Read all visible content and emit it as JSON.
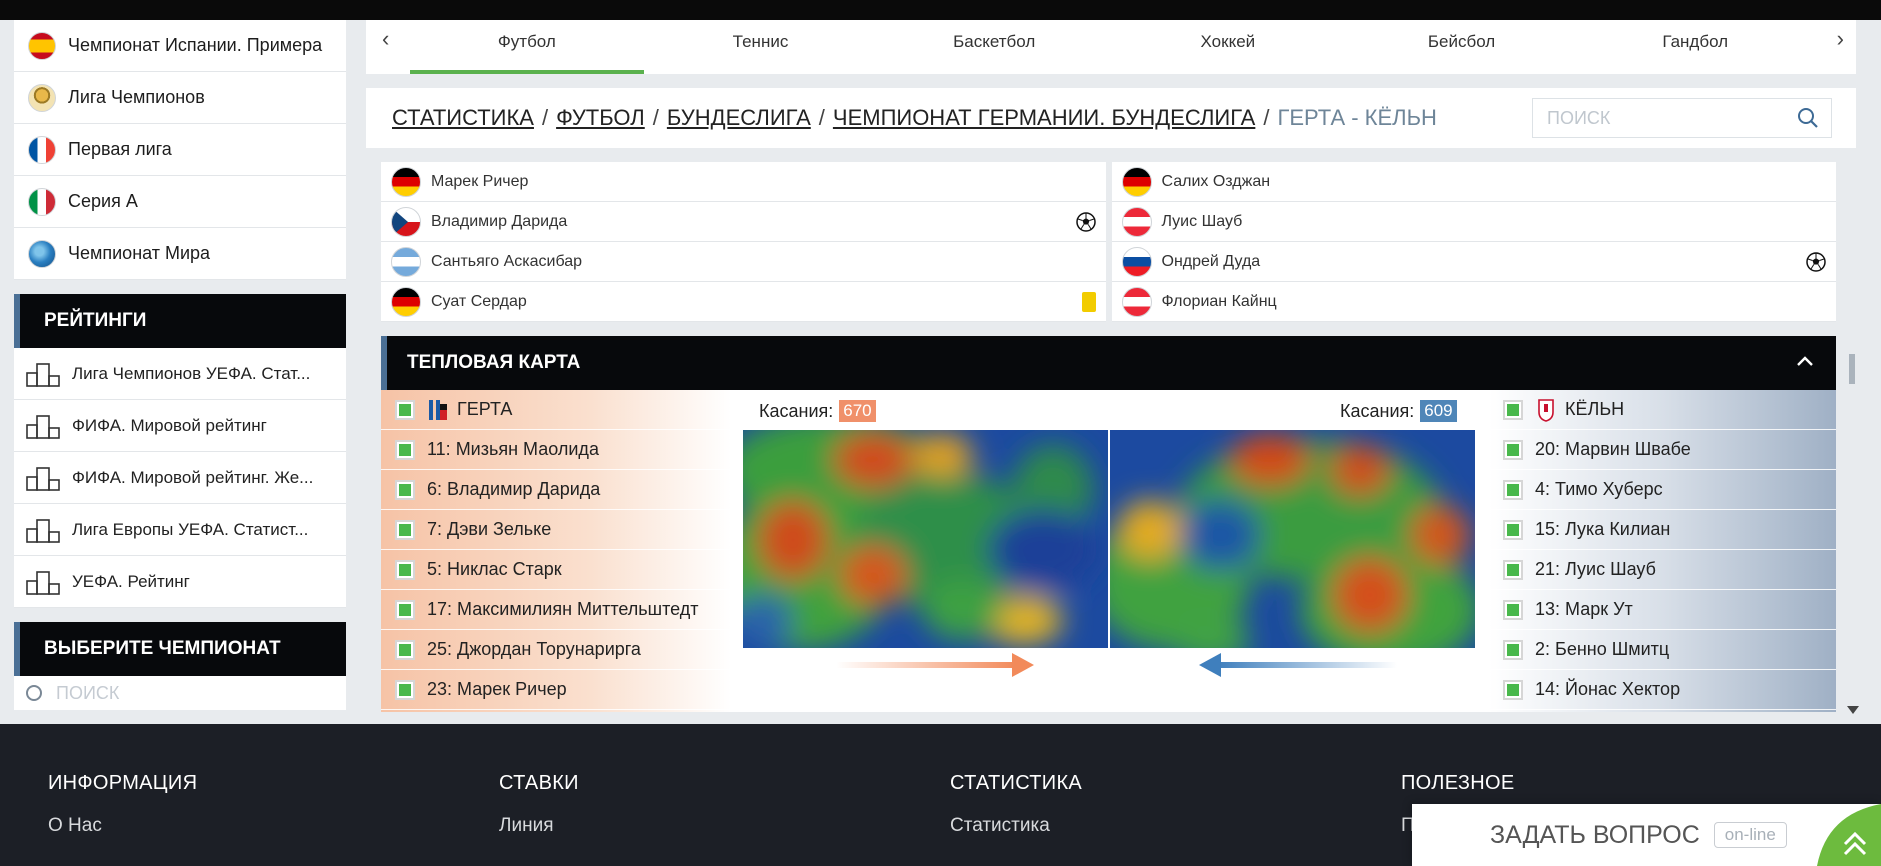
{
  "sidebar": {
    "leagues": [
      {
        "label": "Чемпионат Испании. Примера",
        "icon": "spain-flag-icon"
      },
      {
        "label": "Лига Чемпионов",
        "icon": "trophy-icon"
      },
      {
        "label": "Первая лига",
        "icon": "france-flag-icon"
      },
      {
        "label": "Серия А",
        "icon": "italy-flag-icon"
      },
      {
        "label": "Чемпионат Мира",
        "icon": "globe-icon"
      }
    ],
    "ratings_title": "РЕЙТИНГИ",
    "ratings": [
      {
        "label": "Лига Чемпионов УЕФА. Стат..."
      },
      {
        "label": "ФИФА. Мировой рейтинг"
      },
      {
        "label": "ФИФА. Мировой рейтинг. Же..."
      },
      {
        "label": "Лига Европы УЕФА. Статист..."
      },
      {
        "label": "УЕФА. Рейтинг"
      }
    ],
    "choose_title": "ВЫБЕРИТЕ ЧЕМПИОНАТ",
    "search_placeholder": "ПОИСК"
  },
  "sport_tabs": [
    {
      "label": "Футбол",
      "active": true
    },
    {
      "label": "Теннис"
    },
    {
      "label": "Баскетбол"
    },
    {
      "label": "Хоккей"
    },
    {
      "label": "Бейсбол"
    },
    {
      "label": "Гандбол"
    }
  ],
  "breadcrumb": {
    "items": [
      "СТАТИСТИКА",
      "ФУТБОЛ",
      "БУНДЕСЛИГА",
      "ЧЕМПИОНАТ ГЕРМАНИИ. БУНДЕСЛИГА"
    ],
    "current": "ГЕРТА - КЁЛЬН",
    "search_placeholder": "ПОИСК"
  },
  "lineups": {
    "home": [
      {
        "name": "Марек Ричер",
        "flag": "germany"
      },
      {
        "name": "Владимир Дарида",
        "flag": "czech",
        "event": "goal"
      },
      {
        "name": "Сантьяго Аскасибар",
        "flag": "argentina"
      },
      {
        "name": "Суат Сердар",
        "flag": "germany",
        "event": "yellow-card"
      }
    ],
    "away": [
      {
        "name": "Салих Озджан",
        "flag": "germany"
      },
      {
        "name": "Луис Шауб",
        "flag": "austria"
      },
      {
        "name": "Ондрей Дуда",
        "flag": "slovakia",
        "event": "goal"
      },
      {
        "name": "Флориан Кайнц",
        "flag": "austria"
      }
    ]
  },
  "heatmap": {
    "title": "ТЕПЛОВАЯ КАРТА",
    "home_label": "Касания:",
    "home_touches": "670",
    "away_label": "Касания:",
    "away_touches": "609",
    "home_color": "#f0906a",
    "away_color": "#4f86b8",
    "home_team": "ГЕРТА",
    "away_team": "КЁЛЬН",
    "home_players": [
      "11: Мизьян Маолида",
      "6: Владимир Дарида",
      "7: Дэви Зельке",
      "5: Никлас Старк",
      "17: Максимилиян Миттельштедт",
      "25: Джордан Торунарирга",
      "23: Марек Ричер"
    ],
    "away_players": [
      "20: Марвин Швабе",
      "4: Тимо Хуберс",
      "15: Лука Килиан",
      "21: Луис Шауб",
      "13: Марк Ут",
      "2: Бенно Шмитц",
      "14: Йонас Хектор"
    ]
  },
  "footer": {
    "columns": [
      {
        "title": "ИНФОРМАЦИЯ",
        "link": "О Нас"
      },
      {
        "title": "СТАВКИ",
        "link": "Линия"
      },
      {
        "title": "СТАТИСТИКА",
        "link": "Статистика"
      },
      {
        "title": "ПОЛЕЗНОЕ",
        "link": "П"
      }
    ]
  },
  "ask_widget": {
    "label": "ЗАДАТЬ ВОПРОС",
    "status": "on-line"
  }
}
